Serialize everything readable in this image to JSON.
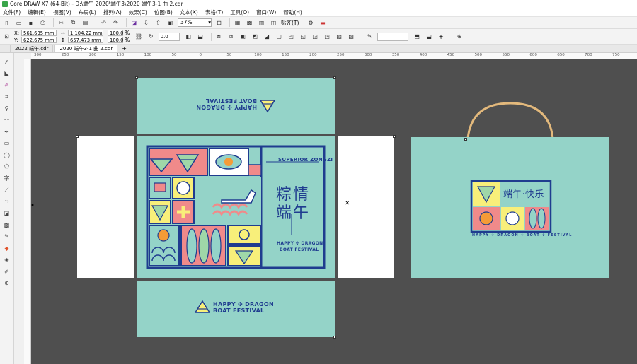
{
  "window": {
    "title": "CorelDRAW X7 (64-Bit) - D:\\端午 2020\\端午3\\2020 端午3-1 曲 2.cdr"
  },
  "menu": [
    "文件(F)",
    "编辑(E)",
    "视图(V)",
    "布局(L)",
    "排列(A)",
    "效果(C)",
    "位图(B)",
    "文本(X)",
    "表格(T)",
    "工具(O)",
    "窗口(W)",
    "帮助(H)"
  ],
  "toolbar": {
    "zoom": "37%",
    "snap_label": "贴齐(T)"
  },
  "propbar": {
    "x": "561.635 mm",
    "y": "622.675 mm",
    "w": "1,104.22 mm",
    "h": "657.473 mm",
    "scale_w": "100.0",
    "scale_h": "100.0",
    "pct": "%",
    "angle": "0.0",
    "x_label": "X:",
    "y_label": "Y:"
  },
  "tabs": [
    "2022 端午.cdr",
    "2020 端午3-1 曲 2.cdr"
  ],
  "ruler": [
    "300",
    "250",
    "200",
    "150",
    "100",
    "50",
    "0",
    "50",
    "100",
    "150",
    "200",
    "250",
    "300",
    "350",
    "400",
    "450",
    "500",
    "550",
    "600",
    "650",
    "700",
    "750"
  ],
  "design": {
    "happy_dragon": "HAPPY ✣ DRAGON",
    "boat_festival": "BOAT FESTIVAL",
    "superior_zongzi": "SUPERIOR ZONGZI",
    "zong_qing": "粽情",
    "duan_wu": "端午",
    "happy_dragon_small": "HAPPY ✣ DRAGON",
    "boat_festival_small": "BOAT FESTIVAL",
    "bag_title": "端午·快乐",
    "bag_footer": "HAPPY ✣ DRAGON ✣ BOAT ✣ FESTIVAL"
  },
  "colors": {
    "teal": "#94d3c8",
    "navy": "#1f3c8f",
    "pink": "#f08a8a",
    "yellow": "#f8ef7a",
    "canvas": "#4f4f4f",
    "handle_tan": "#e3b97c"
  }
}
